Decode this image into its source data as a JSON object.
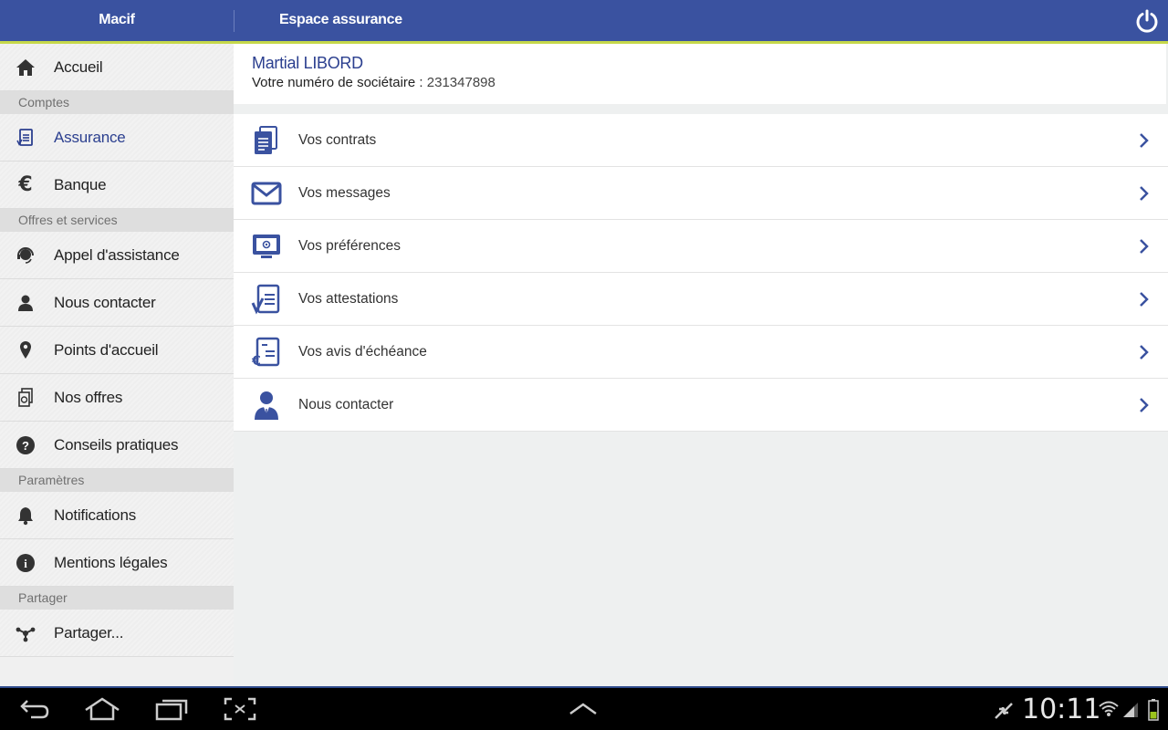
{
  "header": {
    "app_title": "Macif",
    "section_title": "Espace assurance",
    "power_icon": "power-icon"
  },
  "sidebar": {
    "items": [
      {
        "type": "item",
        "label": "Accueil",
        "icon": "home-icon"
      },
      {
        "type": "section",
        "label": "Comptes"
      },
      {
        "type": "item",
        "label": "Assurance",
        "icon": "insurance-doc-icon",
        "active": true
      },
      {
        "type": "item",
        "label": "Banque",
        "icon": "euro-icon"
      },
      {
        "type": "section",
        "label": "Offres et services"
      },
      {
        "type": "item",
        "label": "Appel d'assistance",
        "icon": "headset-icon"
      },
      {
        "type": "item",
        "label": "Nous contacter",
        "icon": "person-icon"
      },
      {
        "type": "item",
        "label": "Points d'accueil",
        "icon": "map-pin-icon"
      },
      {
        "type": "item",
        "label": "Nos offres",
        "icon": "offers-icon"
      },
      {
        "type": "item",
        "label": "Conseils pratiques",
        "icon": "help-icon"
      },
      {
        "type": "section",
        "label": "Paramètres"
      },
      {
        "type": "item",
        "label": "Notifications",
        "icon": "bell-icon"
      },
      {
        "type": "item",
        "label": "Mentions légales",
        "icon": "info-icon"
      },
      {
        "type": "section",
        "label": "Partager"
      },
      {
        "type": "item",
        "label": "Partager...",
        "icon": "share-icon"
      }
    ]
  },
  "user": {
    "name": "Martial LIBORD",
    "member_label": "Votre numéro de sociétaire :",
    "member_number": "231347898"
  },
  "menu": [
    {
      "label": "Vos contrats",
      "icon": "contracts-icon"
    },
    {
      "label": "Vos messages",
      "icon": "envelope-icon"
    },
    {
      "label": "Vos préférences",
      "icon": "preferences-monitor-icon"
    },
    {
      "label": "Vos attestations",
      "icon": "certificate-check-icon"
    },
    {
      "label": "Vos avis d'échéance",
      "icon": "due-notice-euro-icon"
    },
    {
      "label": "Nous contacter",
      "icon": "advisor-icon"
    }
  ],
  "system_bar": {
    "time": "10:11"
  },
  "colors": {
    "brand_blue": "#3a52a0",
    "accent_green": "#c6d84a",
    "active_text": "#2b3f8f"
  }
}
